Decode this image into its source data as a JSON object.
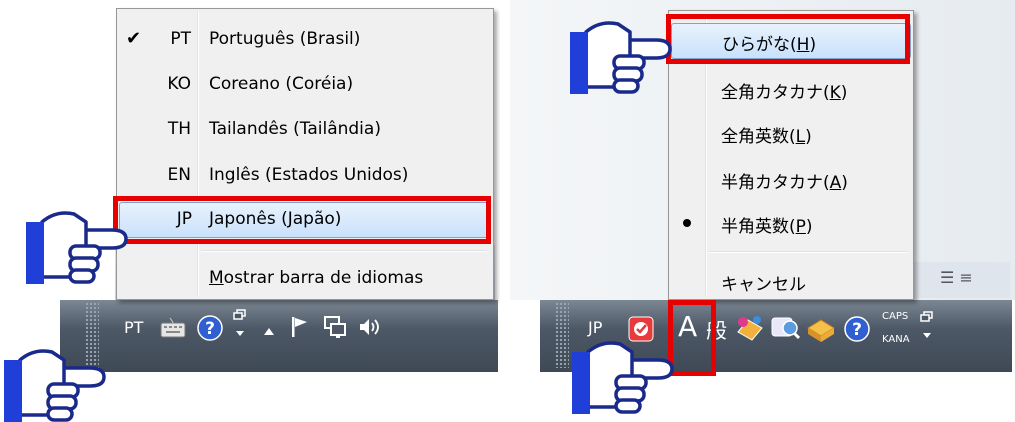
{
  "left_panel": {
    "menu_items": [
      {
        "code": "PT",
        "label": "Português (Brasil)",
        "checked": true
      },
      {
        "code": "KO",
        "label": "Coreano (Coréia)"
      },
      {
        "code": "TH",
        "label": "Tailandês (Tailândia)"
      },
      {
        "code": "EN",
        "label": "Inglês (Estados Unidos)"
      },
      {
        "code": "JP",
        "label": "Japonês (Japão)",
        "highlighted": true
      }
    ],
    "show_bar_label_first": "M",
    "show_bar_label_rest": "ostrar barra de idiomas",
    "taskbar": {
      "lang_code": "PT",
      "icons": [
        "keyboard-icon",
        "help-icon",
        "restore-icon",
        "show-hidden-icon",
        "flag-icon",
        "network-icon",
        "volume-icon"
      ]
    }
  },
  "right_panel": {
    "menu_items": [
      {
        "label": "ひらがな(",
        "key": "H",
        "tail": ")",
        "highlighted": true
      },
      {
        "label": "全角カタカナ(",
        "key": "K",
        "tail": ")"
      },
      {
        "label": "全角英数(",
        "key": "L",
        "tail": ")"
      },
      {
        "label": "半角カタカナ(",
        "key": "A",
        "tail": ")"
      },
      {
        "label": "半角英数(",
        "key": "P",
        "tail": ")",
        "selected_bullet": true
      }
    ],
    "cancel_label": "キャンセル",
    "taskbar": {
      "lang_code": "JP",
      "ime_mode": "A",
      "ime_kanji": "般",
      "caps_label": "CAPS",
      "kana_label": "KANA",
      "icons": [
        "ime-icon",
        "ime-pad-icon",
        "dictionary-icon",
        "tools-icon",
        "help-icon"
      ]
    }
  },
  "colors": {
    "highlight_border": "#e60000",
    "hand_blue": "#1f3fd8",
    "menu_bg": "#f0f0f0",
    "selection_bg": "#c9e1fb"
  }
}
